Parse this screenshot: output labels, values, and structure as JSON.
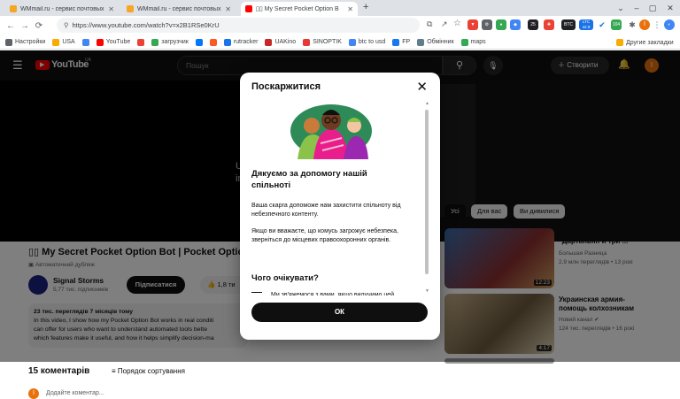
{
  "browser": {
    "tabs": [
      {
        "title": "WMmail.ru - сервис почтовых ра",
        "active": false
      },
      {
        "title": "WMmail.ru - сервис почтовых ра",
        "active": false
      },
      {
        "title": "▯▯ My Secret Pocket Option B",
        "active": true
      }
    ],
    "url": "https://www.youtube.com/watch?v=x2B1RSe0KrU",
    "bookmarks": [
      "Настройки",
      "USA",
      "YouTube",
      "загрузчик",
      "rutracker",
      "UAKino",
      "SINOPTIK",
      "btc to usd",
      "FP",
      "Обмінник",
      "maps"
    ],
    "other_bookmarks": "Другие закладки",
    "ext_labels": {
      "ltc": "LTC 42.9",
      "btc": "BTC",
      "num1": "25",
      "num2": "104"
    }
  },
  "youtube": {
    "logo": "YouTube",
    "logo_region": "UA",
    "search_placeholder": "Пошук",
    "create_label": "Створити",
    "avatar_letter": "І",
    "video_overlay_text": "U\nind",
    "video_title": "▯▯ My Secret Pocket Option Bot | Pocket Optio",
    "auto_dub": "Автоматичний дубляж",
    "channel_name": "Signal Storms",
    "subscribers": "5,77 тис. підписників",
    "subscribe_label": "Підписатися",
    "like_count": "1,8 ти",
    "views_line": "23 тис. переглядів  7 місяців тому",
    "desc_lines": [
      "In this video, I show how my Pocket Option Bot works in real conditi",
      "can offer for users who want to understand automated tools bette",
      "which features make it useful, and how it helps simplify decision-ma"
    ],
    "comments_count": "15 коментарів",
    "sort_label": "Порядок сортування",
    "add_comment_placeholder": "Додайте коментар...",
    "chips": [
      "Усі",
      "Для вас",
      "Ви дивилися"
    ],
    "recommendations": [
      {
        "title_l1": "Пародия на фильм",
        "title_l2": "\"Дартаньян и три ...",
        "channel": "Большая Разница",
        "meta": "2,9 млн переглядів • 13 рокі",
        "duration": "12:23"
      },
      {
        "title_l1": "Украинская армия-",
        "title_l2": "помощь колхозникам",
        "channel": "Новий канал",
        "meta": "124 тис. переглядів • 16 рокі",
        "duration": "4:17"
      }
    ]
  },
  "dialog": {
    "title": "Поскаржитися",
    "thanks": "Дякуємо за допомогу нашій спільноті",
    "p1": "Ваша скарга допоможе нам захистити спільноту від небезпечного контенту.",
    "p2": "Якщо ви вважаєте, що комусь загрожує небезпека, зверніться до місцевих правоохоронних органів.",
    "expect_heading": "Чого очікувати?",
    "partial_text": "Ми зв'яжемося з вами, якщо вилучимо цей",
    "ok_label": "ОК"
  },
  "colors": {
    "yt_red": "#ff0000",
    "dialog_bg": "#ffffff",
    "button_dark": "#0f0f0f"
  }
}
